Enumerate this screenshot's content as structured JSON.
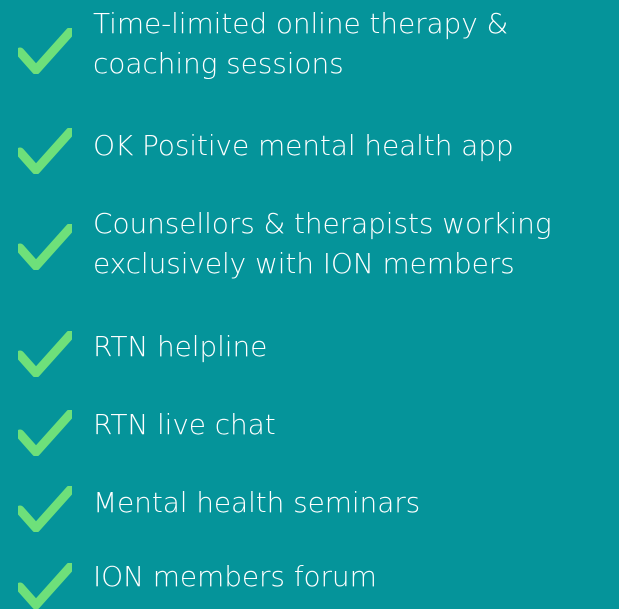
{
  "background_color": "#05949a",
  "check_color": "#6ee07a",
  "benefits": [
    {
      "icon": "check-icon",
      "lines": [
        "Time-limited online therapy &",
        "coaching sessions"
      ]
    },
    {
      "icon": "check-icon",
      "lines": [
        "OK Positive mental health app"
      ]
    },
    {
      "icon": "check-icon",
      "lines": [
        "Counsellors & therapists working",
        "exclusively with ION members"
      ]
    },
    {
      "icon": "check-icon",
      "lines": [
        "RTN helpline"
      ]
    },
    {
      "icon": "check-icon",
      "lines": [
        "RTN live chat"
      ]
    },
    {
      "icon": "check-icon",
      "lines": [
        "Mental health seminars"
      ]
    },
    {
      "icon": "check-icon",
      "lines": [
        "ION members forum"
      ]
    }
  ]
}
